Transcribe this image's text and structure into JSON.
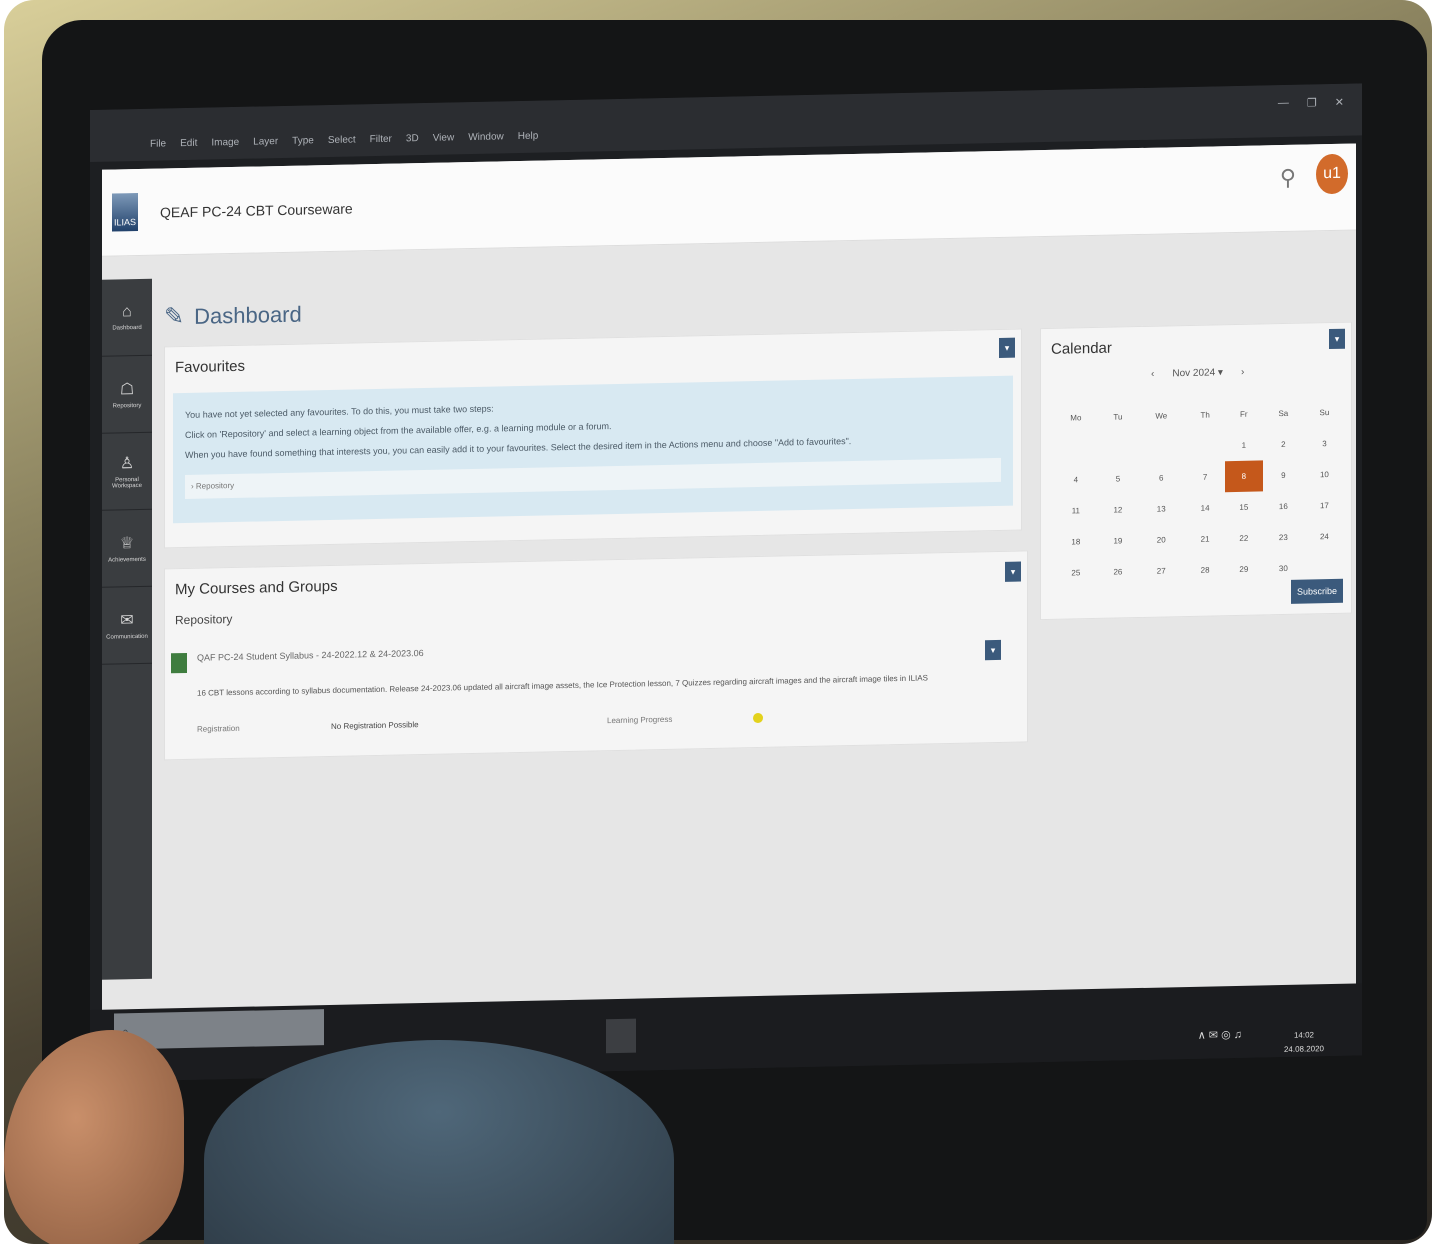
{
  "menubar": {
    "items": [
      "File",
      "Edit",
      "Image",
      "Layer",
      "Type",
      "Select",
      "Filter",
      "3D",
      "View",
      "Window",
      "Help"
    ],
    "window_controls": [
      "—",
      "❐",
      "✕"
    ]
  },
  "app": {
    "logo_text": "ILIAS",
    "title": "QEAF PC-24 CBT Courseware",
    "avatar_initials": "u1"
  },
  "sidebar": {
    "items": [
      {
        "label": "Dashboard",
        "icon": "⌂"
      },
      {
        "label": "Repository",
        "icon": "☖"
      },
      {
        "label": "Personal Workspace",
        "icon": "♙"
      },
      {
        "label": "Achievements",
        "icon": "♕"
      },
      {
        "label": "Communication",
        "icon": "✉"
      }
    ]
  },
  "dashboard": {
    "title": "Dashboard"
  },
  "favourites": {
    "title": "Favourites",
    "line1": "You have not yet selected any favourites. To do this, you must take two steps:",
    "line2": "Click on 'Repository' and select a learning object from the available offer, e.g. a learning module or a forum.",
    "line3": "When you have found something that interests you, you can easily add it to your favourites. Select the desired item in the Actions menu and choose \"Add to favourites\".",
    "repo_link": "› Repository"
  },
  "courses": {
    "title": "My Courses and Groups",
    "subtitle": "Repository",
    "item_title": "QAF PC-24 Student Syllabus - 24-2022.12 & 24-2023.06",
    "item_desc": "16 CBT lessons according to syllabus documentation. Release 24-2023.06 updated all aircraft image assets, the Ice Protection lesson, 7 Quizzes regarding aircraft images and the aircraft image tiles in ILIAS",
    "registration_label": "Registration",
    "registration_value": "No Registration Possible",
    "progress_label": "Learning Progress"
  },
  "calendar": {
    "title": "Calendar",
    "month": "Nov 2024 ▾",
    "prev": "‹",
    "next": "›",
    "weekdays": [
      "Mo",
      "Tu",
      "We",
      "Th",
      "Fr",
      "Sa",
      "Su"
    ],
    "weeks": [
      [
        "",
        "",
        "",
        "",
        "1",
        "2",
        "3"
      ],
      [
        "4",
        "5",
        "6",
        "7",
        "8",
        "9",
        "10"
      ],
      [
        "11",
        "12",
        "13",
        "14",
        "15",
        "16",
        "17"
      ],
      [
        "18",
        "19",
        "20",
        "21",
        "22",
        "23",
        "24"
      ],
      [
        "25",
        "26",
        "27",
        "28",
        "29",
        "30",
        ""
      ]
    ],
    "today": "8",
    "subscribe": "Subscribe"
  },
  "taskbar": {
    "search_icon": "⌕",
    "tray_icons": "∧  ✉  ◎  ♫",
    "time": "14:02",
    "date": "24.08.2020"
  },
  "colors": {
    "accent": "#3b5a7c",
    "today": "#c5581b",
    "avatar": "#d26b2b",
    "info": "#d8e9f2"
  }
}
